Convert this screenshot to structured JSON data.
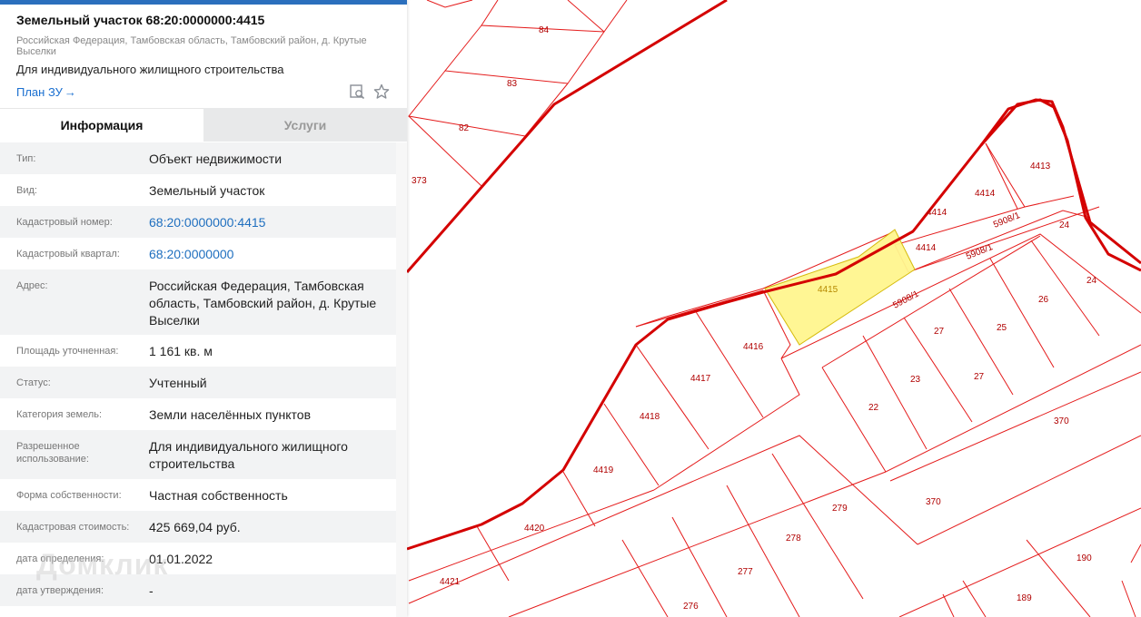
{
  "header": {
    "title": "Земельный участок 68:20:0000000:4415",
    "address": "Российская Федерация, Тамбовская область, Тамбовский район, д. Крутые Выселки",
    "purpose": "Для индивидуального жилищного строительства",
    "plan_link": "План ЗУ",
    "plan_arrow": "→",
    "icons": [
      "search-document-icon",
      "star-icon"
    ]
  },
  "tabs": [
    {
      "label": "Информация",
      "active": true
    },
    {
      "label": "Услуги",
      "active": false
    }
  ],
  "info_rows": [
    {
      "label": "Тип:",
      "value": "Объект недвижимости"
    },
    {
      "label": "Вид:",
      "value": "Земельный участок"
    },
    {
      "label": "Кадастровый номер:",
      "value": "68:20:0000000:4415",
      "link": true
    },
    {
      "label": "Кадастровый квартал:",
      "value": "68:20:0000000",
      "link": true
    },
    {
      "label": "Адрес:",
      "value": "Российская Федерация, Тамбовская область, Тамбовский район, д. Крутые Выселки"
    },
    {
      "label": "Площадь уточненная:",
      "value": "1 161 кв. м"
    },
    {
      "label": "Статус:",
      "value": "Учтенный"
    },
    {
      "label": "Категория земель:",
      "value": "Земли населённых пунктов"
    },
    {
      "label": "Разрешенное использование:",
      "value": "Для индивидуального жилищного строительства"
    },
    {
      "label": "Форма собственности:",
      "value": "Частная собственность"
    },
    {
      "label": "Кадастровая стоимость:",
      "value": "425 669,04 руб."
    },
    {
      "label": "дата определения:",
      "value": "01.01.2022"
    },
    {
      "label": "дата утверждения:",
      "value": "-"
    }
  ],
  "watermark": "Домклик",
  "colors": {
    "accent": "#2b6fbd",
    "link": "#1f6fbf",
    "parcel_line": "#e00000",
    "boundary_line": "#cc0000",
    "selected_fill": "#fff68f",
    "label": "#b00000"
  },
  "map": {
    "labels": [
      "84",
      "83",
      "82",
      "373",
      "4413",
      "4414",
      "4414",
      "4414",
      "5908/1",
      "5908/1",
      "5908/1",
      "24",
      "24",
      "4415",
      "26",
      "4416",
      "27",
      "25",
      "4417",
      "23",
      "27",
      "22",
      "4418",
      "370",
      "4419",
      "279",
      "370",
      "4420",
      "278",
      "190",
      "277",
      "4421",
      "276",
      "189"
    ]
  }
}
